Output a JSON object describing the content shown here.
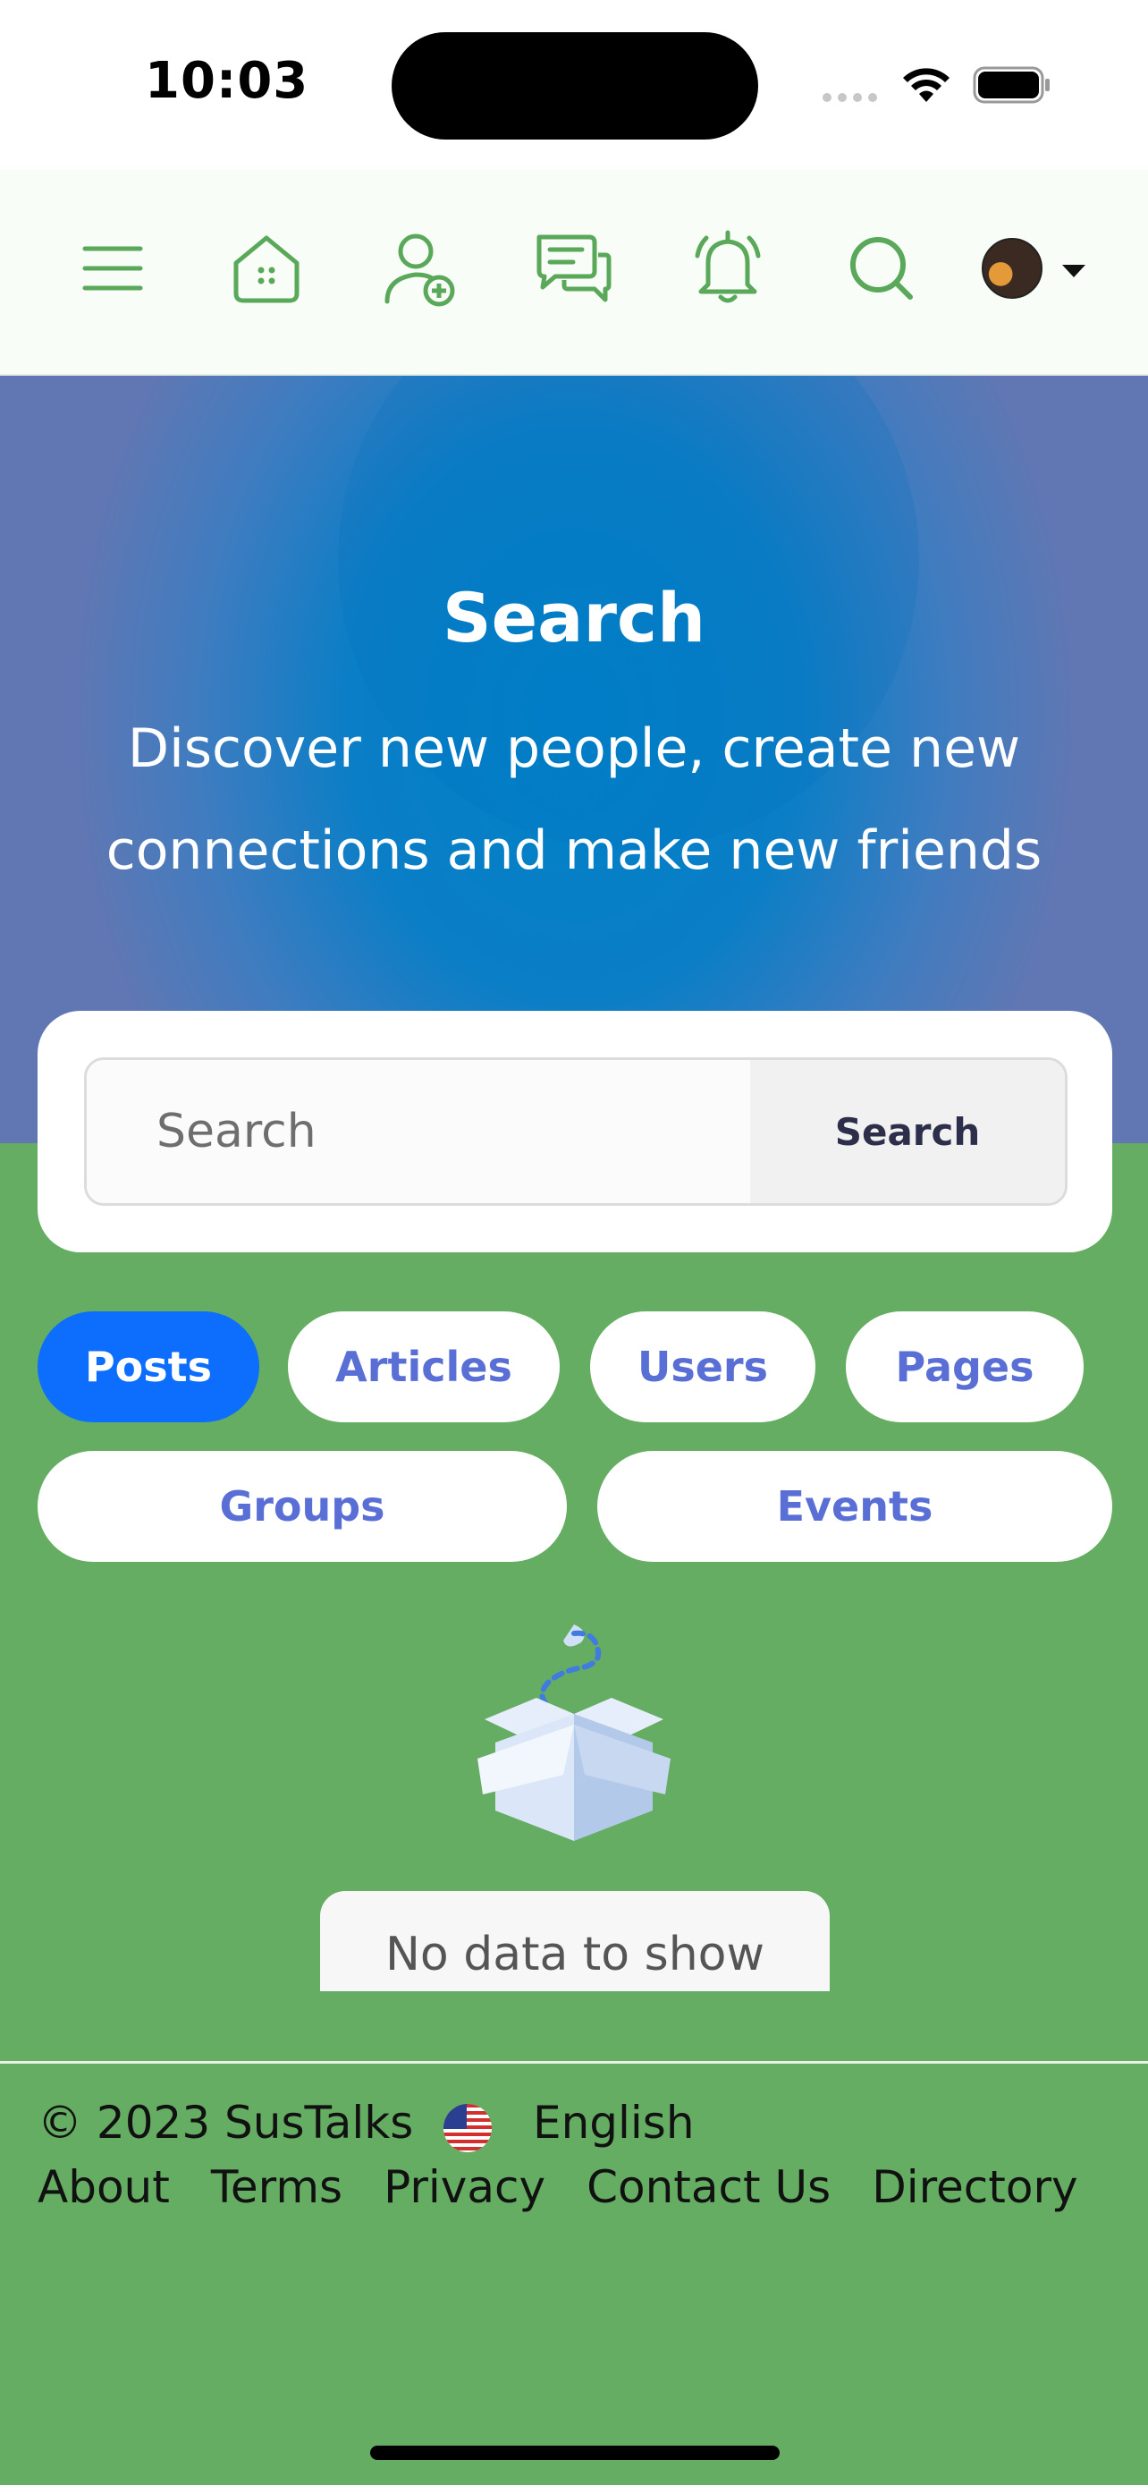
{
  "status_bar": {
    "time": "10:03"
  },
  "navbar": {
    "icons": [
      "menu-icon",
      "home-icon",
      "add-friend-icon",
      "messages-icon",
      "notifications-icon",
      "search-icon"
    ],
    "accent_color": "#5aa85a"
  },
  "hero": {
    "title": "Search",
    "subtitle": "Discover new people, create new connections and make new friends"
  },
  "search": {
    "placeholder": "Search",
    "button_label": "Search"
  },
  "tabs": [
    {
      "label": "Posts",
      "active": true
    },
    {
      "label": "Articles",
      "active": false
    },
    {
      "label": "Users",
      "active": false
    },
    {
      "label": "Pages",
      "active": false
    },
    {
      "label": "Groups",
      "active": false
    },
    {
      "label": "Events",
      "active": false
    }
  ],
  "empty_state": {
    "message": "No data to show"
  },
  "footer": {
    "copyright": "© 2023 SusTalks",
    "language": "English",
    "links": [
      "About",
      "Terms",
      "Privacy",
      "Contact Us",
      "Directory"
    ]
  },
  "colors": {
    "page_bg": "#65ad62",
    "active_tab": "#0d6efd",
    "tab_text": "#5a6fd6",
    "hero_blue": "#0081c8"
  }
}
